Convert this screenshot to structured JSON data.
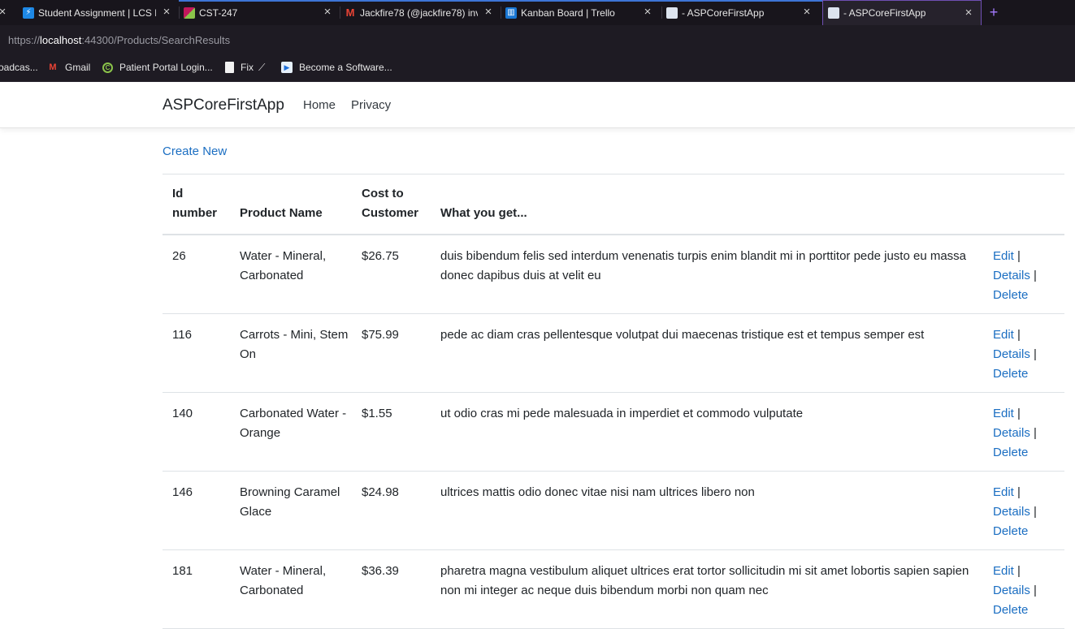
{
  "browser": {
    "tabs": [
      {
        "title": "Student Assignment | LCS L",
        "icon": "lightning-icon",
        "icon_color": "#1e88e5"
      },
      {
        "title": "CST-247",
        "icon": "cst-icon",
        "icon_color": "#c2185b"
      },
      {
        "title": "Jackfire78 (@jackfire78) inv",
        "icon": "gmail-icon",
        "icon_color": "#ea4335"
      },
      {
        "title": "Kanban Board | Trello",
        "icon": "trello-icon",
        "icon_color": "#1976d2"
      },
      {
        "title": "- ASPCoreFirstApp",
        "icon": "page-icon",
        "icon_color": "#dce3ee"
      },
      {
        "title": "- ASPCoreFirstApp",
        "icon": "page-icon",
        "icon_color": "#dce3ee",
        "active": true
      }
    ],
    "new_tab_label": "+",
    "close_label": "×",
    "url_prefix": "https://",
    "url_host": "localhost",
    "url_rest": ":44300/Products/SearchResults",
    "bookmarks": [
      {
        "label": "oadcas...",
        "icon": ""
      },
      {
        "label": "Gmail",
        "icon": "gmail-icon"
      },
      {
        "label": "Patient Portal Login...",
        "icon": "portal-icon"
      },
      {
        "label": "Fix",
        "icon": "document-icon"
      },
      {
        "label": "Become a Software...",
        "icon": "play-icon"
      }
    ]
  },
  "navbar": {
    "brand": "ASPCoreFirstApp",
    "links": [
      "Home",
      "Privacy"
    ]
  },
  "main": {
    "create_new": "Create New",
    "table": {
      "headers": {
        "id_line1": "Id",
        "id_line2": "number",
        "name": "Product Name",
        "cost_line1": "Cost to",
        "cost_line2": "Customer",
        "desc": "What you get..."
      },
      "actions": {
        "edit": "Edit",
        "details": "Details",
        "delete": "Delete",
        "separator": "|"
      },
      "rows": [
        {
          "id": "26",
          "name": "Water - Mineral, Carbonated",
          "cost": "$26.75",
          "desc": "duis bibendum felis sed interdum venenatis turpis enim blandit mi in porttitor pede justo eu massa donec dapibus duis at velit eu"
        },
        {
          "id": "116",
          "name": "Carrots - Mini, Stem On",
          "cost": "$75.99",
          "desc": "pede ac diam cras pellentesque volutpat dui maecenas tristique est et tempus semper est"
        },
        {
          "id": "140",
          "name": "Carbonated Water - Orange",
          "cost": "$1.55",
          "desc": "ut odio cras mi pede malesuada in imperdiet et commodo vulputate"
        },
        {
          "id": "146",
          "name": "Browning Caramel Glace",
          "cost": "$24.98",
          "desc": "ultrices mattis odio donec vitae nisi nam ultrices libero non"
        },
        {
          "id": "181",
          "name": "Water - Mineral, Carbonated",
          "cost": "$36.39",
          "desc": "pharetra magna vestibulum aliquet ultrices erat tortor sollicitudin mi sit amet lobortis sapien sapien non mi integer ac neque duis bibendum morbi non quam nec"
        }
      ]
    }
  }
}
